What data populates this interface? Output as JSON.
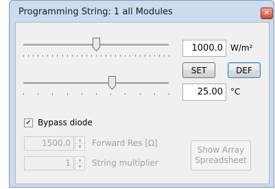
{
  "window": {
    "title": "Programming String: 1 all Modules"
  },
  "irradiance": {
    "slider_level": 0.5,
    "value": "1000.0",
    "unit": "W/m²"
  },
  "buttons": {
    "set_label": "SET",
    "def_label": "DEF"
  },
  "temperature": {
    "slider_level": 0.61,
    "value": "25.00",
    "unit": "°C"
  },
  "bypass": {
    "checkbox_label": "Bypass diode",
    "checked": true,
    "forward_res_value": "1500.0",
    "forward_res_label": "Forward Res [Ω]",
    "string_multiplier_value": "1",
    "string_multiplier_label": "String multiplier"
  },
  "spreadsheet_button": {
    "line1": "Show Array",
    "line2": "Spreadsheet"
  },
  "icons": {
    "close": "close-icon",
    "check": "check-icon",
    "spin_up": "spin-up-icon",
    "spin_down": "spin-down-icon"
  }
}
